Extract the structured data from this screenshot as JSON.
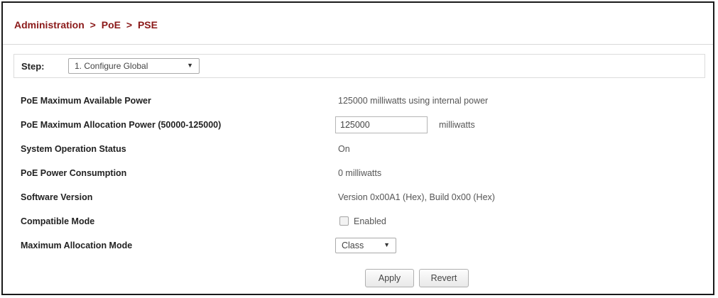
{
  "breadcrumb": {
    "items": [
      "Administration",
      "PoE",
      "PSE"
    ],
    "separator": ">"
  },
  "step": {
    "label": "Step:",
    "selected": "1. Configure Global"
  },
  "fields": [
    {
      "label": "PoE Maximum Available Power",
      "value": "125000 milliwatts using internal power"
    },
    {
      "label": "PoE Maximum Allocation Power (50000-125000)",
      "input_value": "125000",
      "unit": "milliwatts"
    },
    {
      "label": "System Operation Status",
      "value": "On"
    },
    {
      "label": "PoE Power Consumption",
      "value": "0 milliwatts"
    },
    {
      "label": "Software Version",
      "value": "Version 0x00A1 (Hex), Build 0x00 (Hex)"
    },
    {
      "label": "Compatible Mode",
      "checkbox_label": "Enabled",
      "checked": false
    },
    {
      "label": "Maximum Allocation Mode",
      "selected": "Class"
    }
  ],
  "buttons": {
    "apply": "Apply",
    "revert": "Revert"
  },
  "colors": {
    "breadcrumb": "#8b1a1a",
    "frame_border": "#1a1a1a"
  },
  "icons": {
    "dropdown": "chevron-down-icon"
  }
}
